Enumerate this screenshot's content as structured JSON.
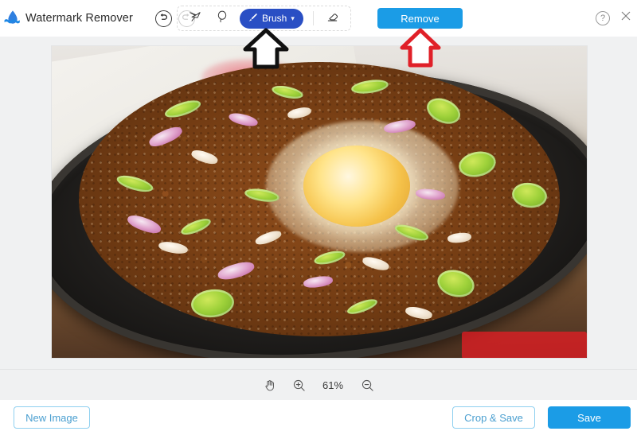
{
  "app": {
    "title": "Watermark Remover",
    "logo_icon": "water-drop-wave-icon"
  },
  "topbar": {
    "undo_icon": "undo-arrow-icon",
    "redo_icon": "redo-arrow-icon",
    "undo_label": "Undo",
    "redo_label": "Redo",
    "tools": [
      {
        "id": "polygonal-lasso",
        "icon": "polygonal-lasso-icon",
        "label": "Polygonal Lasso",
        "active": false
      },
      {
        "id": "lasso",
        "icon": "lasso-icon",
        "label": "Lasso",
        "active": false
      }
    ],
    "brush": {
      "label": "Brush",
      "icon": "brush-icon",
      "chevron": "⌄",
      "active": true,
      "color": "#2a4fc4"
    },
    "eraser": {
      "icon": "eraser-icon",
      "label": "Eraser"
    },
    "remove_button": {
      "label": "Remove",
      "color": "#1b9ce6"
    },
    "help": {
      "label": "?",
      "icon": "help-circle-icon"
    },
    "close": {
      "icon": "close-icon",
      "label": "Close"
    }
  },
  "canvas": {
    "image_alt": "Sizzling sisig with egg yolk, green chili and red onion on a cast iron plate",
    "brush_mask": {
      "color": "#ed1c24",
      "opacity": 0.72,
      "label": "brush selection over watermark"
    }
  },
  "annotations": [
    {
      "id": "arrow-brush",
      "color": "#111111",
      "points_to": "Brush tool",
      "shape": "up-arrow-outline"
    },
    {
      "id": "arrow-remove",
      "color": "#e02028",
      "points_to": "Remove button",
      "shape": "up-arrow-outline"
    }
  ],
  "zoombar": {
    "hand_icon": "hand-tool-icon",
    "hand_label": "Pan",
    "zoom_in_icon": "zoom-in-icon",
    "zoom_in_label": "Zoom In",
    "zoom_out_icon": "zoom-out-icon",
    "zoom_out_label": "Zoom Out",
    "zoom_level": "61%"
  },
  "footer": {
    "new_image_label": "New Image",
    "crop_save_label": "Crop & Save",
    "save_label": "Save",
    "accent_color": "#1b9ce6",
    "outline_color": "#8fd0f0"
  }
}
